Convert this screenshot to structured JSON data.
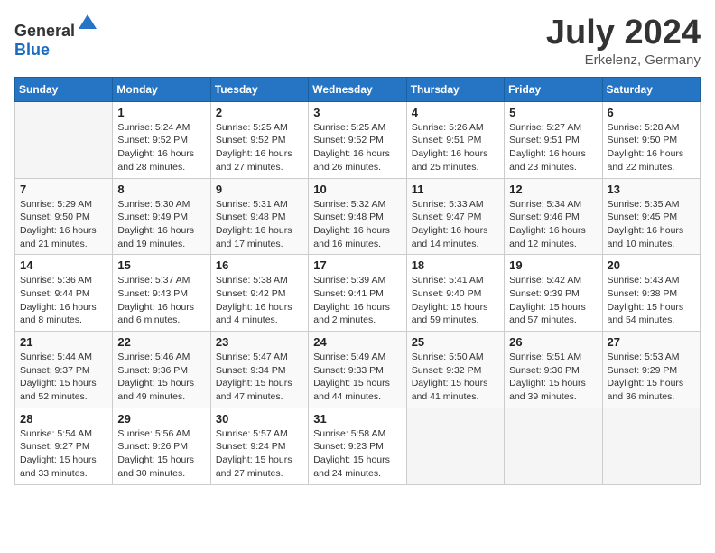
{
  "logo": {
    "text_general": "General",
    "text_blue": "Blue"
  },
  "title": {
    "month_year": "July 2024",
    "location": "Erkelenz, Germany"
  },
  "weekdays": [
    "Sunday",
    "Monday",
    "Tuesday",
    "Wednesday",
    "Thursday",
    "Friday",
    "Saturday"
  ],
  "weeks": [
    [
      {
        "day": "",
        "sunrise": "",
        "sunset": "",
        "daylight": ""
      },
      {
        "day": "1",
        "sunrise": "Sunrise: 5:24 AM",
        "sunset": "Sunset: 9:52 PM",
        "daylight": "Daylight: 16 hours and 28 minutes."
      },
      {
        "day": "2",
        "sunrise": "Sunrise: 5:25 AM",
        "sunset": "Sunset: 9:52 PM",
        "daylight": "Daylight: 16 hours and 27 minutes."
      },
      {
        "day": "3",
        "sunrise": "Sunrise: 5:25 AM",
        "sunset": "Sunset: 9:52 PM",
        "daylight": "Daylight: 16 hours and 26 minutes."
      },
      {
        "day": "4",
        "sunrise": "Sunrise: 5:26 AM",
        "sunset": "Sunset: 9:51 PM",
        "daylight": "Daylight: 16 hours and 25 minutes."
      },
      {
        "day": "5",
        "sunrise": "Sunrise: 5:27 AM",
        "sunset": "Sunset: 9:51 PM",
        "daylight": "Daylight: 16 hours and 23 minutes."
      },
      {
        "day": "6",
        "sunrise": "Sunrise: 5:28 AM",
        "sunset": "Sunset: 9:50 PM",
        "daylight": "Daylight: 16 hours and 22 minutes."
      }
    ],
    [
      {
        "day": "7",
        "sunrise": "Sunrise: 5:29 AM",
        "sunset": "Sunset: 9:50 PM",
        "daylight": "Daylight: 16 hours and 21 minutes."
      },
      {
        "day": "8",
        "sunrise": "Sunrise: 5:30 AM",
        "sunset": "Sunset: 9:49 PM",
        "daylight": "Daylight: 16 hours and 19 minutes."
      },
      {
        "day": "9",
        "sunrise": "Sunrise: 5:31 AM",
        "sunset": "Sunset: 9:48 PM",
        "daylight": "Daylight: 16 hours and 17 minutes."
      },
      {
        "day": "10",
        "sunrise": "Sunrise: 5:32 AM",
        "sunset": "Sunset: 9:48 PM",
        "daylight": "Daylight: 16 hours and 16 minutes."
      },
      {
        "day": "11",
        "sunrise": "Sunrise: 5:33 AM",
        "sunset": "Sunset: 9:47 PM",
        "daylight": "Daylight: 16 hours and 14 minutes."
      },
      {
        "day": "12",
        "sunrise": "Sunrise: 5:34 AM",
        "sunset": "Sunset: 9:46 PM",
        "daylight": "Daylight: 16 hours and 12 minutes."
      },
      {
        "day": "13",
        "sunrise": "Sunrise: 5:35 AM",
        "sunset": "Sunset: 9:45 PM",
        "daylight": "Daylight: 16 hours and 10 minutes."
      }
    ],
    [
      {
        "day": "14",
        "sunrise": "Sunrise: 5:36 AM",
        "sunset": "Sunset: 9:44 PM",
        "daylight": "Daylight: 16 hours and 8 minutes."
      },
      {
        "day": "15",
        "sunrise": "Sunrise: 5:37 AM",
        "sunset": "Sunset: 9:43 PM",
        "daylight": "Daylight: 16 hours and 6 minutes."
      },
      {
        "day": "16",
        "sunrise": "Sunrise: 5:38 AM",
        "sunset": "Sunset: 9:42 PM",
        "daylight": "Daylight: 16 hours and 4 minutes."
      },
      {
        "day": "17",
        "sunrise": "Sunrise: 5:39 AM",
        "sunset": "Sunset: 9:41 PM",
        "daylight": "Daylight: 16 hours and 2 minutes."
      },
      {
        "day": "18",
        "sunrise": "Sunrise: 5:41 AM",
        "sunset": "Sunset: 9:40 PM",
        "daylight": "Daylight: 15 hours and 59 minutes."
      },
      {
        "day": "19",
        "sunrise": "Sunrise: 5:42 AM",
        "sunset": "Sunset: 9:39 PM",
        "daylight": "Daylight: 15 hours and 57 minutes."
      },
      {
        "day": "20",
        "sunrise": "Sunrise: 5:43 AM",
        "sunset": "Sunset: 9:38 PM",
        "daylight": "Daylight: 15 hours and 54 minutes."
      }
    ],
    [
      {
        "day": "21",
        "sunrise": "Sunrise: 5:44 AM",
        "sunset": "Sunset: 9:37 PM",
        "daylight": "Daylight: 15 hours and 52 minutes."
      },
      {
        "day": "22",
        "sunrise": "Sunrise: 5:46 AM",
        "sunset": "Sunset: 9:36 PM",
        "daylight": "Daylight: 15 hours and 49 minutes."
      },
      {
        "day": "23",
        "sunrise": "Sunrise: 5:47 AM",
        "sunset": "Sunset: 9:34 PM",
        "daylight": "Daylight: 15 hours and 47 minutes."
      },
      {
        "day": "24",
        "sunrise": "Sunrise: 5:49 AM",
        "sunset": "Sunset: 9:33 PM",
        "daylight": "Daylight: 15 hours and 44 minutes."
      },
      {
        "day": "25",
        "sunrise": "Sunrise: 5:50 AM",
        "sunset": "Sunset: 9:32 PM",
        "daylight": "Daylight: 15 hours and 41 minutes."
      },
      {
        "day": "26",
        "sunrise": "Sunrise: 5:51 AM",
        "sunset": "Sunset: 9:30 PM",
        "daylight": "Daylight: 15 hours and 39 minutes."
      },
      {
        "day": "27",
        "sunrise": "Sunrise: 5:53 AM",
        "sunset": "Sunset: 9:29 PM",
        "daylight": "Daylight: 15 hours and 36 minutes."
      }
    ],
    [
      {
        "day": "28",
        "sunrise": "Sunrise: 5:54 AM",
        "sunset": "Sunset: 9:27 PM",
        "daylight": "Daylight: 15 hours and 33 minutes."
      },
      {
        "day": "29",
        "sunrise": "Sunrise: 5:56 AM",
        "sunset": "Sunset: 9:26 PM",
        "daylight": "Daylight: 15 hours and 30 minutes."
      },
      {
        "day": "30",
        "sunrise": "Sunrise: 5:57 AM",
        "sunset": "Sunset: 9:24 PM",
        "daylight": "Daylight: 15 hours and 27 minutes."
      },
      {
        "day": "31",
        "sunrise": "Sunrise: 5:58 AM",
        "sunset": "Sunset: 9:23 PM",
        "daylight": "Daylight: 15 hours and 24 minutes."
      },
      {
        "day": "",
        "sunrise": "",
        "sunset": "",
        "daylight": ""
      },
      {
        "day": "",
        "sunrise": "",
        "sunset": "",
        "daylight": ""
      },
      {
        "day": "",
        "sunrise": "",
        "sunset": "",
        "daylight": ""
      }
    ]
  ]
}
